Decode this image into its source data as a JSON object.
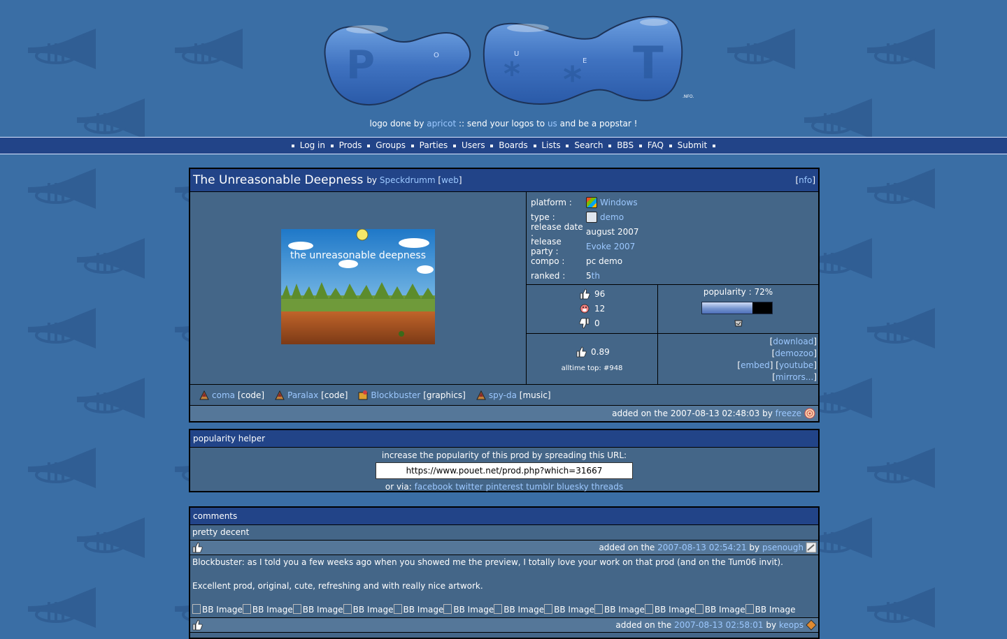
{
  "site": {
    "logo_caption": {
      "prefix": "logo done by",
      "author": "apricot",
      "middle": ":: send your logos to",
      "us": "us",
      "suffix": "and be a popstar !"
    },
    "logo_letters": [
      "P",
      "O",
      "U",
      "E",
      "T"
    ],
    "logo_mark": ".NFO."
  },
  "nav": [
    "Log in",
    "Prods",
    "Groups",
    "Parties",
    "Users",
    "Boards",
    "Lists",
    "Search",
    "BBS",
    "FAQ",
    "Submit"
  ],
  "prod": {
    "title": "The Unreasonable Deepness",
    "by": "by",
    "group": "Speckdrumm",
    "web": "web",
    "nfo": "nfo",
    "screenshot_text": "the unreasonable deepness",
    "info": [
      {
        "label": "platform :",
        "value": "Windows",
        "icon": "windows-icon"
      },
      {
        "label": "type :",
        "value": "demo",
        "icon": "demo-icon"
      },
      {
        "label": "release date :",
        "value": "august 2007"
      },
      {
        "label": "release party :",
        "value": "Evoke 2007"
      },
      {
        "label": "compo :",
        "value": "pc demo"
      },
      {
        "label": "ranked :",
        "value_prefix": "5",
        "value_suffix": "th"
      }
    ],
    "votes": {
      "rulez": "96",
      "piggie": "12",
      "sucks": "0"
    },
    "popularity": {
      "label": "popularity : 72%",
      "value": 72
    },
    "average": "0.89",
    "alltime": "alltime top: #948",
    "links": [
      [
        "download"
      ],
      [
        "demozoo"
      ],
      [
        "embed",
        "youtube"
      ],
      [
        "mirrors..."
      ]
    ],
    "credits": [
      {
        "name": "coma",
        "role": "[code]"
      },
      {
        "name": "Paralax",
        "role": "[code]"
      },
      {
        "name": "Blockbuster",
        "role": "[graphics]"
      },
      {
        "name": "spy-da",
        "role": "[music]"
      }
    ],
    "added": {
      "prefix": "added on the 2007-08-13 02:48:03 by",
      "user": "freeze"
    }
  },
  "helper": {
    "title": "popularity helper",
    "text": "increase the popularity of this prod by spreading this URL:",
    "url": "https://www.pouet.net/prod.php?which=31667",
    "via": "or via:",
    "networks": [
      "facebook",
      "twitter",
      "pinterest",
      "tumblr",
      "bluesky",
      "threads"
    ]
  },
  "comments": {
    "title": "comments",
    "items": [
      {
        "lines": [
          "pretty decent"
        ],
        "date": "2007-08-13 02:54:21",
        "user": "psenough"
      },
      {
        "lines": [
          "Blockbuster: as I told you a few weeks ago when you showed me the preview, I totally love your work on that prod (and on the Tum06 invit).",
          "",
          "Excellent prod, original, cute, refreshing and with really nice artwork.",
          ""
        ],
        "images": [
          "BB Image",
          "BB Image",
          "BB Image",
          "BB Image",
          "BB Image",
          "BB Image",
          "BB Image",
          "BB Image",
          "BB Image",
          "BB Image",
          "BB Image",
          "BB Image"
        ],
        "date": "2007-08-13 02:58:01",
        "user": "keops"
      }
    ],
    "added_label": "added on the",
    "by_label": "by"
  },
  "colors": {
    "background": "#3a6ea5",
    "header": "#224488",
    "box": "#446688",
    "link": "#9cc8ff"
  }
}
